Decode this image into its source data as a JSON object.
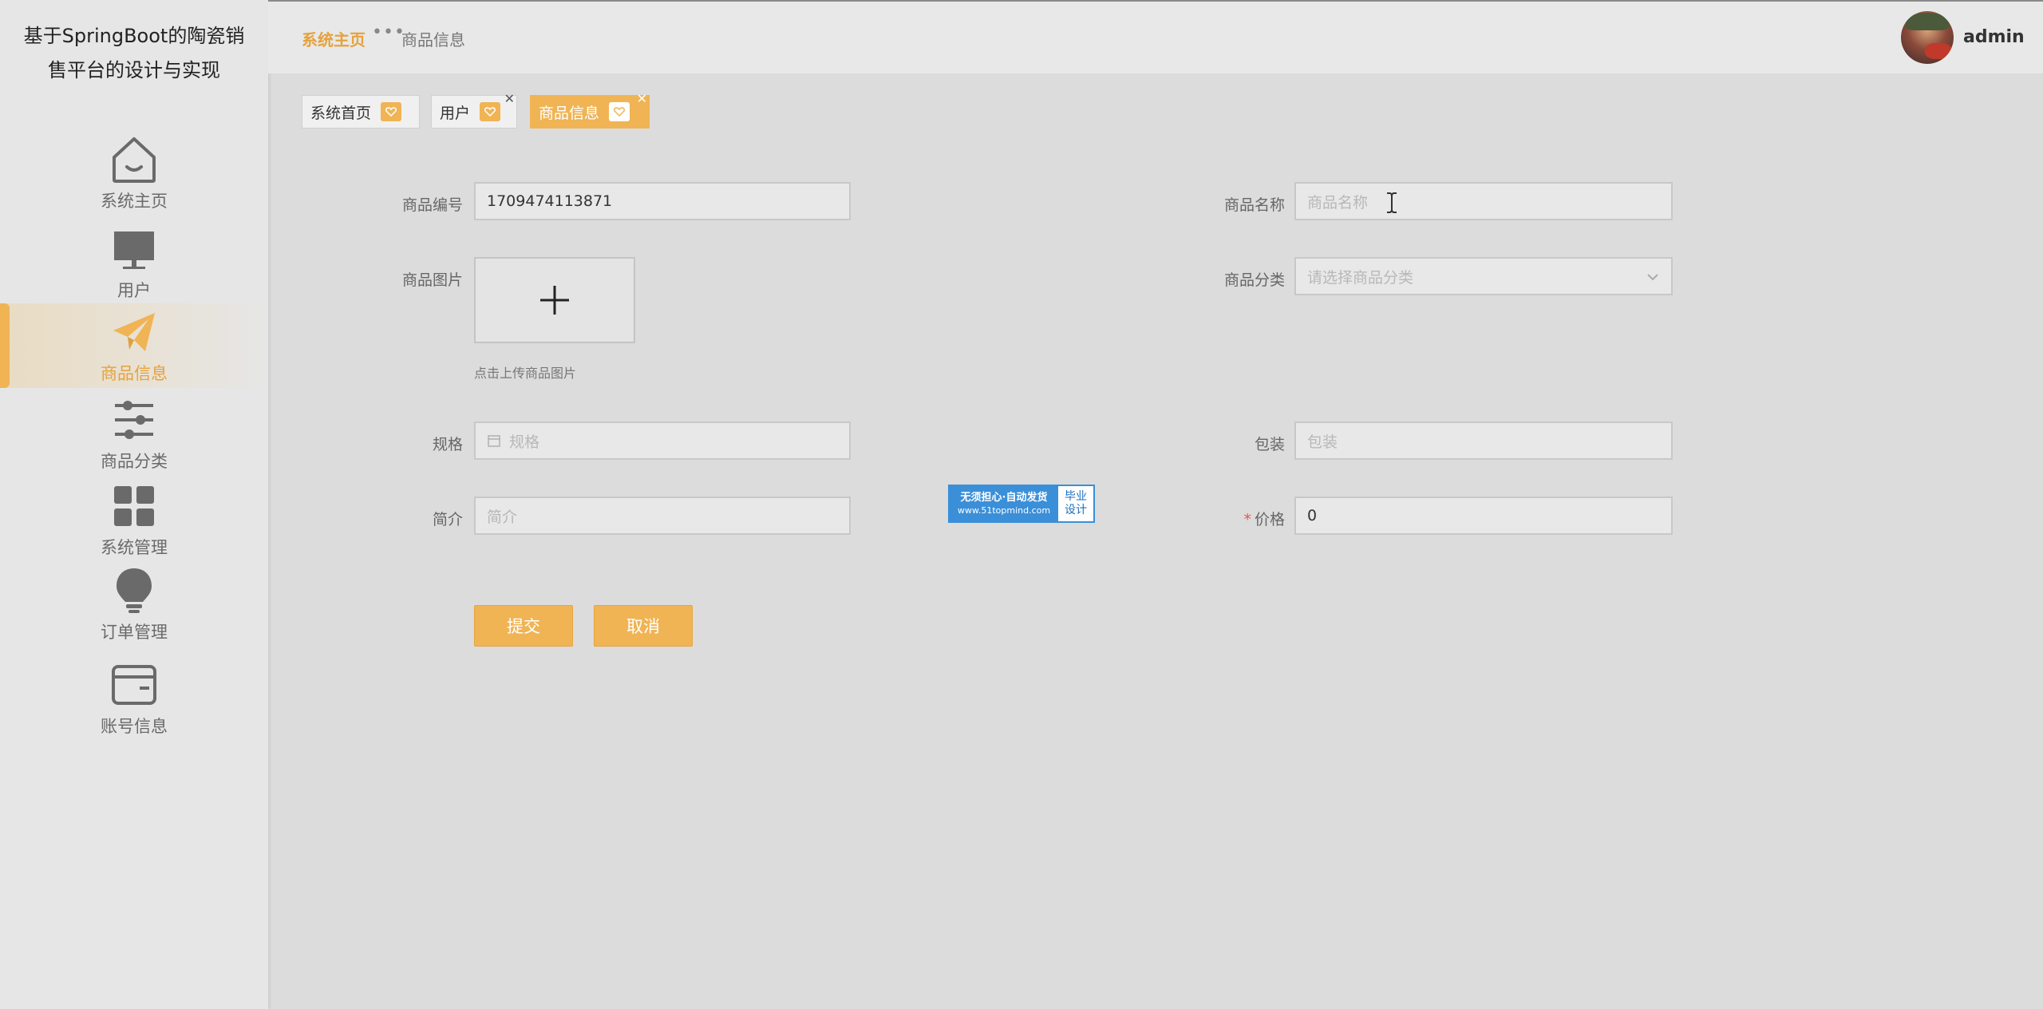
{
  "app": {
    "title_line1": "基于SpringBoot的陶瓷销",
    "title_line2": "售平台的设计与实现"
  },
  "sidebar": {
    "items": [
      {
        "label": "系统主页",
        "icon": "home-icon",
        "active": false
      },
      {
        "label": "用户",
        "icon": "monitor-icon",
        "active": false
      },
      {
        "label": "商品信息",
        "icon": "paper-plane-icon",
        "active": true
      },
      {
        "label": "商品分类",
        "icon": "sliders-icon",
        "active": false
      },
      {
        "label": "系统管理",
        "icon": "grid-icon",
        "active": false
      },
      {
        "label": "订单管理",
        "icon": "lightbulb-icon",
        "active": false
      },
      {
        "label": "账号信息",
        "icon": "wallet-icon",
        "active": false
      }
    ]
  },
  "header": {
    "breadcrumb_home": "系统主页",
    "breadcrumb_separator": "•••",
    "breadcrumb_current": "商品信息",
    "username": "admin"
  },
  "tabs": [
    {
      "label": "系统首页",
      "closable": false,
      "active": false
    },
    {
      "label": "用户",
      "closable": true,
      "active": false
    },
    {
      "label": "商品信息",
      "closable": true,
      "active": true
    }
  ],
  "form": {
    "product_code": {
      "label": "商品编号",
      "value": "1709474113871"
    },
    "product_name": {
      "label": "商品名称",
      "placeholder": "商品名称"
    },
    "product_image": {
      "label": "商品图片",
      "hint": "点击上传商品图片"
    },
    "product_category": {
      "label": "商品分类",
      "placeholder": "请选择商品分类"
    },
    "spec": {
      "label": "规格",
      "placeholder": "规格"
    },
    "packaging": {
      "label": "包装",
      "placeholder": "包装"
    },
    "intro": {
      "label": "简介",
      "placeholder": "简介"
    },
    "price": {
      "label": "价格",
      "required_mark": "*",
      "value": "0"
    },
    "submit_label": "提交",
    "cancel_label": "取消"
  },
  "watermark": {
    "line1": "无须担心·自动发货",
    "line2": "www.51topmind.com",
    "right1": "毕业",
    "right2": "设计"
  },
  "colors": {
    "accent": "#f0b455",
    "accent_text": "#e6a23c",
    "required": "#e05a4e"
  }
}
